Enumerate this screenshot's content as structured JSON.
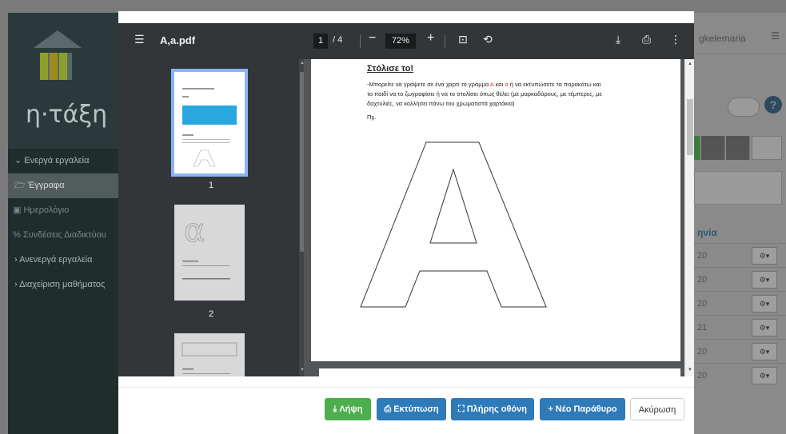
{
  "background": {
    "logo_text": "η·τάξη",
    "menu": [
      {
        "label": "Ενεργά εργαλεία",
        "icon": "chevron-down-icon",
        "glyph": "⌄"
      },
      {
        "label": "Έγγραφα",
        "icon": "folder-icon",
        "glyph": "🗁"
      },
      {
        "label": "Ημερολόγιο",
        "icon": "calendar-icon",
        "glyph": "▣"
      },
      {
        "label": "Συνδέσεις Διαδικτύου",
        "icon": "link-icon",
        "glyph": "%"
      },
      {
        "label": "Ανενεργά εργαλεία",
        "icon": "chevron-right-icon",
        "glyph": "›"
      },
      {
        "label": "Διαχείριση μαθήματος",
        "icon": "chevron-right-icon",
        "glyph": "›"
      }
    ],
    "username": "gkelemaria",
    "column_header": "ηνία",
    "dates": [
      "20",
      "20",
      "20",
      "21",
      "20",
      "20"
    ]
  },
  "viewer": {
    "title": "A,a.pdf",
    "page_current": "1",
    "page_total": "/ 4",
    "zoom": "72%",
    "thumbnails": [
      "1",
      "2"
    ],
    "page": {
      "heading": "Στόλισε το!",
      "line1_a": "-Μπορείτε να γράψετε σε ένα  χαρτί το γράμμα",
      "line1_b": "Α",
      "line1_c": "και",
      "line1_d": "α",
      "line1_e": "ή να εκτυπώσετε τα παρακάτω  και",
      "line2": "το παιδί να το ζωγραφίσει  ή να το στολίσει όπως θέλει (με μαρκαδόρους, με τέμπερες, με",
      "line3": "δαχτυλιές, να κολλήσει πάνω του χρωματιστά χαρτάκια)",
      "eg": "Πχ."
    }
  },
  "footer": {
    "download": "Λήψη",
    "print": "Εκτύπωση",
    "fullscreen": "Πλήρης οθόνη",
    "new_window": "Νέο Παράθυρο",
    "cancel": "Ακύρωση"
  },
  "colors": {
    "download": "#4cae4c",
    "print": "#2f7ab9",
    "fullscreen": "#2f7ab9",
    "new_window": "#2f7ab9",
    "toolbar": "#323639"
  }
}
